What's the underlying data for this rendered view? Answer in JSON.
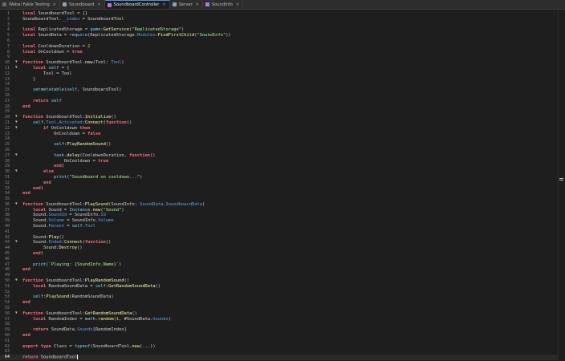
{
  "tabs": [
    {
      "label": "Webal Fakle Testing",
      "icon_color": "#6a6a6a",
      "active": false
    },
    {
      "label": "Soundboard",
      "icon_color": "#8fa6b8",
      "active": false
    },
    {
      "label": "SoundboardController",
      "icon_color": "#b07cd8",
      "active": true
    },
    {
      "label": "Server",
      "icon_color": "#8fa6b8",
      "active": false
    },
    {
      "label": "SoundInfo",
      "icon_color": "#b07cd8",
      "active": false
    }
  ],
  "colors": {
    "keyword": "#f86d7c",
    "function_name": "#fdfbac",
    "string": "#adf195",
    "number": "#ffc600",
    "property": "#61a1f1",
    "builtin": "#84d6f7",
    "text": "#d4d4d4",
    "background": "#1e1e1e"
  },
  "editor": {
    "current_line": 64,
    "lines": [
      {
        "n": "1",
        "text": "local SoundboardTool = {}"
      },
      {
        "n": "2",
        "text": "SoundboardTool.__index = SoundboardTool"
      },
      {
        "n": "3",
        "text": ""
      },
      {
        "n": "4",
        "text": "local ReplicatedStorage = game:GetService(\"ReplicatedStorage\")"
      },
      {
        "n": "5",
        "text": "local SoundData = require(ReplicatedStorage.Modules:FindFirstChild(\"SoundInfo\"))"
      },
      {
        "n": "6",
        "text": ""
      },
      {
        "n": "7",
        "text": "local CooldownDuration = 2"
      },
      {
        "n": "8",
        "text": "local OnCooldown = true"
      },
      {
        "n": "9",
        "text": ""
      },
      {
        "n": "10",
        "text": "function SoundboardTool.new(Tool: Tool)",
        "fold": true
      },
      {
        "n": "11",
        "text": "    local self = {",
        "fold": true
      },
      {
        "n": "12",
        "text": "        Tool = Tool"
      },
      {
        "n": "13",
        "text": "    }"
      },
      {
        "n": "14",
        "text": ""
      },
      {
        "n": "15",
        "text": "    setmetatable(self, SoundboardTool)"
      },
      {
        "n": "16",
        "text": ""
      },
      {
        "n": "17",
        "text": "    return self"
      },
      {
        "n": "18",
        "text": "end"
      },
      {
        "n": "19",
        "text": ""
      },
      {
        "n": "20",
        "text": "function SoundboardTool:Initialize()",
        "fold": true
      },
      {
        "n": "21",
        "text": "    self.Tool.Activated:Connect(function()",
        "fold": true
      },
      {
        "n": "22",
        "text": "        if OnCooldown then",
        "fold": true
      },
      {
        "n": "23",
        "text": "            OnCooldown = false"
      },
      {
        "n": "24",
        "text": ""
      },
      {
        "n": "25",
        "text": "            self:PlayRandomSound()"
      },
      {
        "n": "26",
        "text": ""
      },
      {
        "n": "27",
        "text": "            task.delay(CooldownDuration, function()",
        "fold": true
      },
      {
        "n": "28",
        "text": "                OnCooldown = true"
      },
      {
        "n": "29",
        "text": "            end)"
      },
      {
        "n": "30",
        "text": "        else",
        "fold": true
      },
      {
        "n": "31",
        "text": "            print(\"Soundboard on cooldown...\")"
      },
      {
        "n": "32",
        "text": "        end"
      },
      {
        "n": "33",
        "text": "    end)"
      },
      {
        "n": "34",
        "text": "end"
      },
      {
        "n": "35",
        "text": ""
      },
      {
        "n": "36",
        "text": "function SoundboardTool:PlaySound(SoundInfo: SoundData.SoundboardData)",
        "fold": true
      },
      {
        "n": "37",
        "text": "    local Sound = Instance.new(\"Sound\")"
      },
      {
        "n": "38",
        "text": "    Sound.SoundId = SoundInfo.Id"
      },
      {
        "n": "39",
        "text": "    Sound.Volume = SoundInfo.Volume"
      },
      {
        "n": "40",
        "text": "    Sound.Parent = self.Tool"
      },
      {
        "n": "41",
        "text": ""
      },
      {
        "n": "42",
        "text": "    Sound:Play()"
      },
      {
        "n": "43",
        "text": "    Sound.Ended:Connect(function()",
        "fold": true
      },
      {
        "n": "44",
        "text": "        Sound:Destroy()"
      },
      {
        "n": "45",
        "text": "    end)"
      },
      {
        "n": "46",
        "text": ""
      },
      {
        "n": "47",
        "text": "    print(`Playing: {SoundInfo.Name}`)"
      },
      {
        "n": "48",
        "text": "end"
      },
      {
        "n": "49",
        "text": ""
      },
      {
        "n": "50",
        "text": "function SoundboardTool:PlayRandomSound()",
        "fold": true
      },
      {
        "n": "51",
        "text": "    local RandomSoundData = self:GetRandomSoundData()"
      },
      {
        "n": "52",
        "text": ""
      },
      {
        "n": "53",
        "text": "    self:PlaySound(RandomSoundData)"
      },
      {
        "n": "54",
        "text": "end"
      },
      {
        "n": "55",
        "text": ""
      },
      {
        "n": "56",
        "text": "function SoundboardTool:GetRandomSoundData()",
        "fold": true
      },
      {
        "n": "57",
        "text": "    local RandomIndex = math.random(1, #SoundData.Sounds)"
      },
      {
        "n": "58",
        "text": ""
      },
      {
        "n": "59",
        "text": "    return SoundData.Sounds[RandomIndex]"
      },
      {
        "n": "60",
        "text": "end"
      },
      {
        "n": "61",
        "text": ""
      },
      {
        "n": "62",
        "text": "export type Class = typeof(SoundboardTool.new(...))"
      },
      {
        "n": "63",
        "text": ""
      },
      {
        "n": "64",
        "text": "return SoundboardTool"
      }
    ]
  }
}
